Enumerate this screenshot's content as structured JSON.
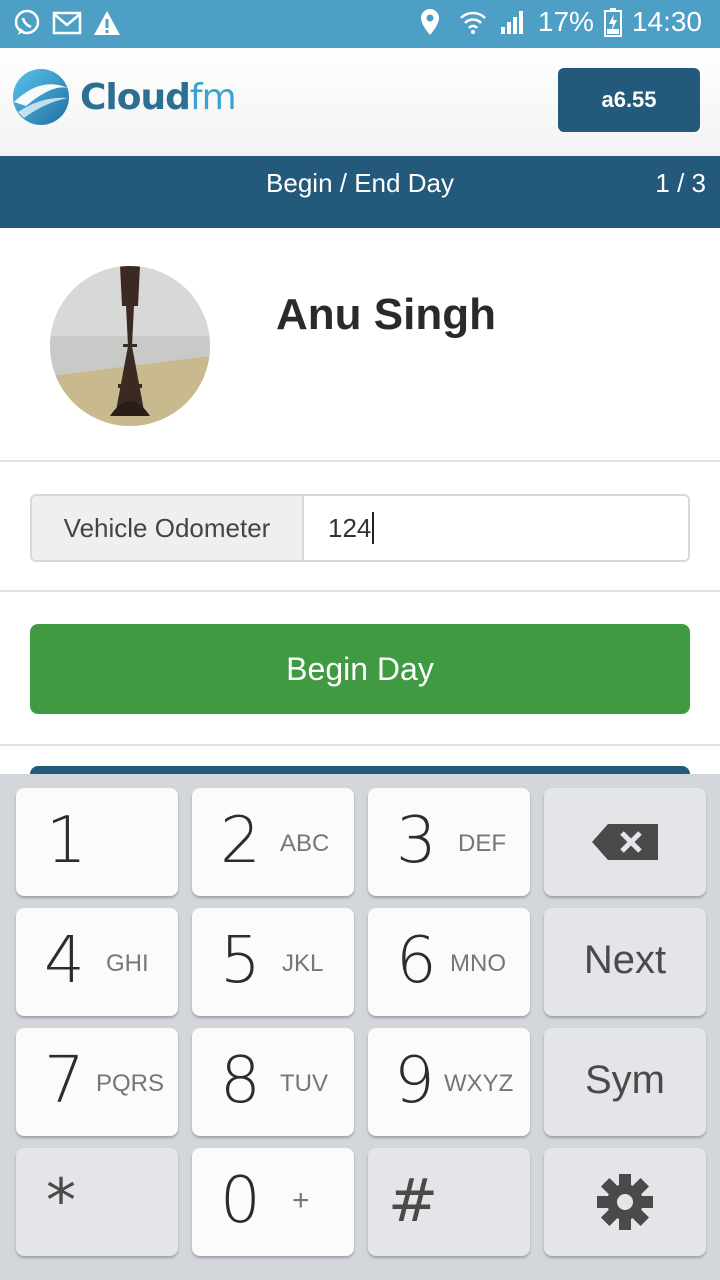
{
  "status_bar": {
    "battery": "17%",
    "time": "14:30",
    "left_icons": [
      "whatsapp-icon",
      "gmail-icon",
      "warning-icon"
    ],
    "right_icons": [
      "location-icon",
      "wifi-icon",
      "signal-icon",
      "battery-charging-icon"
    ]
  },
  "header": {
    "logo_text_main": "Cloud",
    "logo_text_accent": "fm",
    "version_label": "a6.55"
  },
  "title_bar": {
    "title": "Begin / End Day",
    "pager": "1 / 3"
  },
  "profile": {
    "name": "Anu Singh",
    "avatar_icon": "eiffel-tower-photo"
  },
  "odometer": {
    "label": "Vehicle Odometer",
    "value": "124"
  },
  "actions": {
    "begin_day_label": "Begin Day"
  },
  "keyboard": {
    "keys": [
      {
        "num": "1",
        "letters": ""
      },
      {
        "num": "2",
        "letters": "ABC"
      },
      {
        "num": "3",
        "letters": "DEF"
      },
      {
        "num": "4",
        "letters": "GHI"
      },
      {
        "num": "5",
        "letters": "JKL"
      },
      {
        "num": "6",
        "letters": "MNO"
      },
      {
        "num": "7",
        "letters": "PQRS"
      },
      {
        "num": "8",
        "letters": "TUV"
      },
      {
        "num": "9",
        "letters": "WXYZ"
      },
      {
        "num": "0",
        "letters": "+"
      }
    ],
    "next_label": "Next",
    "sym_label": "Sym",
    "star_label": "*",
    "hash_label": "#"
  },
  "colors": {
    "status_bar": "#4d9fc6",
    "primary": "#23597a",
    "success": "#3f9a42",
    "keyboard_bg": "#d3d6db"
  }
}
